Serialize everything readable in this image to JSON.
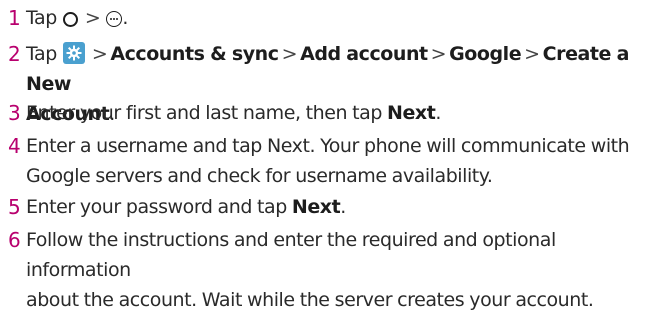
{
  "steps": [
    {
      "number": "1",
      "parts": {
        "t1": "Tap",
        "t2": ".",
        "gt": ">"
      }
    },
    {
      "number": "2",
      "parts": {
        "t1": "Tap",
        "b1": "Accounts & sync",
        "b2": "Add account",
        "b3": "Google",
        "b4": "Create a New",
        "b5": "Account",
        "end": ".",
        "gt": ">"
      }
    },
    {
      "number": "3",
      "parts": {
        "t1": "Enter your first and last name, then tap ",
        "b1": "Next",
        "end": "."
      }
    },
    {
      "number": "4",
      "parts": {
        "l1": "Enter a username and tap Next. Your phone will communicate with",
        "l2": "Google servers and check for username availability."
      }
    },
    {
      "number": "5",
      "parts": {
        "t1": "Enter your password and tap ",
        "b1": "Next",
        "end": "."
      }
    },
    {
      "number": "6",
      "parts": {
        "l1": "Follow the instructions and enter the required and optional information",
        "l2": "about the account. Wait while the server creates your account."
      }
    }
  ],
  "icons": {
    "home": "home-circle-icon",
    "apps": "apps-menu-icon",
    "settings": "settings-gear-icon",
    "settings_color": "#4aa0cf"
  },
  "colors": {
    "step_number": "#b8006e",
    "text": "#2a2a2a"
  }
}
